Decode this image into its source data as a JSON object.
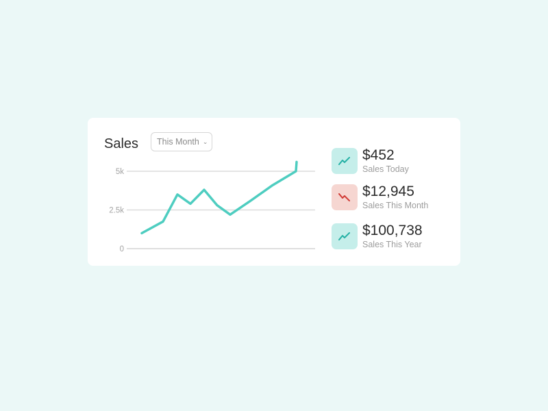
{
  "card": {
    "title": "Sales",
    "period_select": {
      "selected": "This Month"
    }
  },
  "colors": {
    "background": "#ebf8f7",
    "accent": "#4ecdc0",
    "up_badge": "#c5eeea",
    "down_badge": "#f6d6d1",
    "down_icon": "#d03a34",
    "up_icon": "#23b0a4"
  },
  "stats": [
    {
      "value": "$452",
      "label": "Sales Today",
      "trend": "up",
      "icon": "trend-up-icon"
    },
    {
      "value": "$12,945",
      "label": "Sales This Month",
      "trend": "down",
      "icon": "trend-down-icon"
    },
    {
      "value": "$100,738",
      "label": "Sales This Year",
      "trend": "up",
      "icon": "trend-up-icon"
    }
  ],
  "chart_data": {
    "type": "line",
    "title": "",
    "xlabel": "",
    "ylabel": "",
    "y_ticks": [
      "5k",
      "2.5k",
      "0"
    ],
    "ylim": [
      0,
      5000
    ],
    "grid": true,
    "legend": "none",
    "series": [
      {
        "values": [
          1000,
          1750,
          3500,
          2900,
          3800,
          2800,
          2200,
          3100,
          4100,
          5000,
          5600
        ]
      }
    ]
  }
}
